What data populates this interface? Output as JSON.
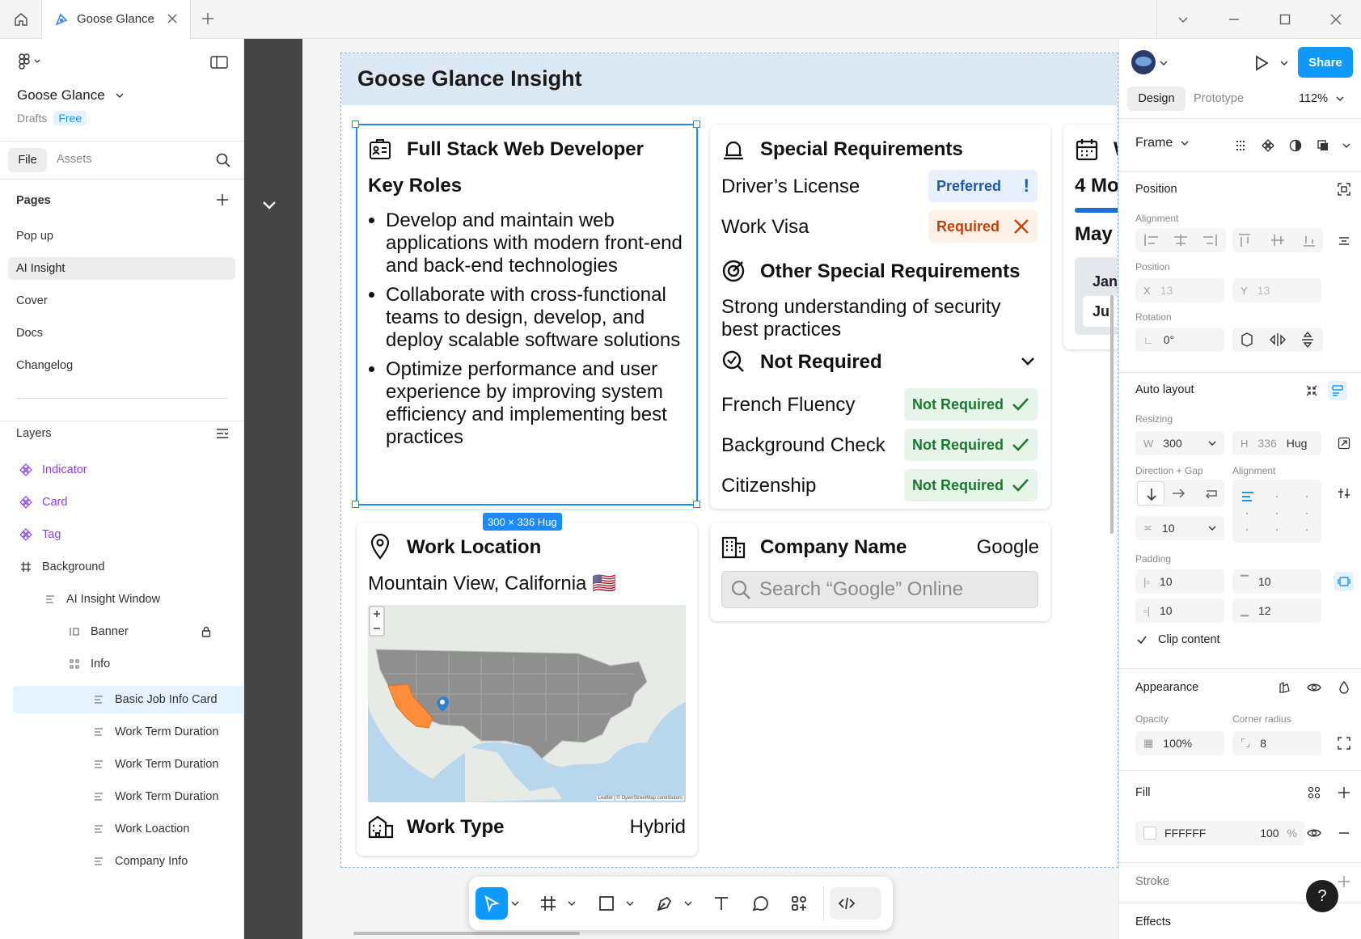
{
  "tabs": {
    "active_title": "Goose Glance"
  },
  "project": {
    "name": "Goose Glance",
    "location": "Drafts",
    "plan": "Free",
    "file_tab": "File",
    "assets_tab": "Assets"
  },
  "pages": {
    "header": "Pages",
    "items": [
      "Pop up",
      "AI Insight",
      "Cover",
      "Docs",
      "Changelog"
    ],
    "selected": "AI Insight"
  },
  "layers": {
    "header": "Layers",
    "items": [
      {
        "label": "Indicator",
        "kind": "component"
      },
      {
        "label": "Card",
        "kind": "component"
      },
      {
        "label": "Tag",
        "kind": "component"
      },
      {
        "label": "Background",
        "kind": "frame"
      },
      {
        "label": "AI Insight Window",
        "kind": "autolayout"
      },
      {
        "label": "Banner",
        "kind": "autolayout-h"
      },
      {
        "label": "Info",
        "kind": "grid"
      },
      {
        "label": "Basic Job Info Card",
        "kind": "autolayout",
        "selected": true
      },
      {
        "label": "Work Term Duration",
        "kind": "autolayout"
      },
      {
        "label": "Work Term Duration",
        "kind": "autolayout"
      },
      {
        "label": "Work Term Duration",
        "kind": "autolayout"
      },
      {
        "label": "Work Loaction",
        "kind": "autolayout"
      },
      {
        "label": "Company Info",
        "kind": "autolayout"
      }
    ]
  },
  "canvas": {
    "banner_title": "Goose Glance Insight",
    "job_card": {
      "title": "Full Stack Web Developer",
      "section": "Key Roles",
      "roles": [
        "Develop and maintain web applications with modern front-end and back-end technologies",
        "Collaborate with cross-functional teams to design, develop, and deploy scalable software solutions",
        "Optimize performance and user experience by improving system efficiency and implementing best practices"
      ]
    },
    "size_tag": "300 × 336 Hug",
    "requirements": {
      "title": "Special Requirements",
      "rows": [
        {
          "label": "Driver’s License",
          "badge": "Preferred",
          "symbol": "!"
        },
        {
          "label": "Work Visa",
          "badge": "Required",
          "symbol": "✕"
        }
      ],
      "other_title": "Other Special Requirements",
      "other_text": "Strong understanding of security best practices",
      "not_required_title": "Not Required",
      "not_required": [
        {
          "label": "French Fluency",
          "badge": "Not Required"
        },
        {
          "label": "Background Check",
          "badge": "Not Required"
        },
        {
          "label": "Citizenship",
          "badge": "Not Required"
        }
      ]
    },
    "work_term": {
      "title_partial": "W",
      "duration_partial": "4 Mo",
      "date_partial": "May",
      "months": [
        "Jan",
        "Jul"
      ]
    },
    "location": {
      "title": "Work Location",
      "place": "Mountain View, California 🇺🇸",
      "map_attribution": "Leaflet | © OpenStreetMap contributors",
      "work_type_label": "Work Type",
      "work_type_value": "Hybrid"
    },
    "company": {
      "title": "Company Name",
      "value": "Google",
      "search_placeholder": "Search “Google” Online"
    }
  },
  "right_panel": {
    "share": "Share",
    "tabs": [
      "Design",
      "Prototype"
    ],
    "zoom": "112%",
    "frame_label": "Frame",
    "position": {
      "title": "Position",
      "alignment_label": "Alignment",
      "position_label": "Position",
      "x": "13",
      "y": "13",
      "rotation_label": "Rotation",
      "rotation": "0°"
    },
    "auto_layout": {
      "title": "Auto layout",
      "resizing_label": "Resizing",
      "w": "300",
      "h": "336",
      "h_mode": "Hug",
      "direction_label": "Direction + Gap",
      "alignment_label": "Alignment",
      "gap": "10",
      "padding_label": "Padding",
      "pad_left": "10",
      "pad_top": "10",
      "pad_right": "10",
      "pad_bottom": "12",
      "clip_label": "Clip content"
    },
    "appearance": {
      "title": "Appearance",
      "opacity_label": "Opacity",
      "opacity": "100%",
      "radius_label": "Corner radius",
      "radius": "8"
    },
    "fill": {
      "title": "Fill",
      "hex": "FFFFFF",
      "opacity": "100",
      "unit": "%"
    },
    "stroke": {
      "title": "Stroke"
    },
    "effects": {
      "title": "Effects"
    }
  },
  "colors": {
    "accent": "#0d99ff",
    "component": "#8a3ffc",
    "banner": "#dce8f3",
    "selection": "#1a8cff",
    "preferred": "#1a5aa8",
    "required": "#c2410c",
    "not_required": "#1a7a2e"
  }
}
